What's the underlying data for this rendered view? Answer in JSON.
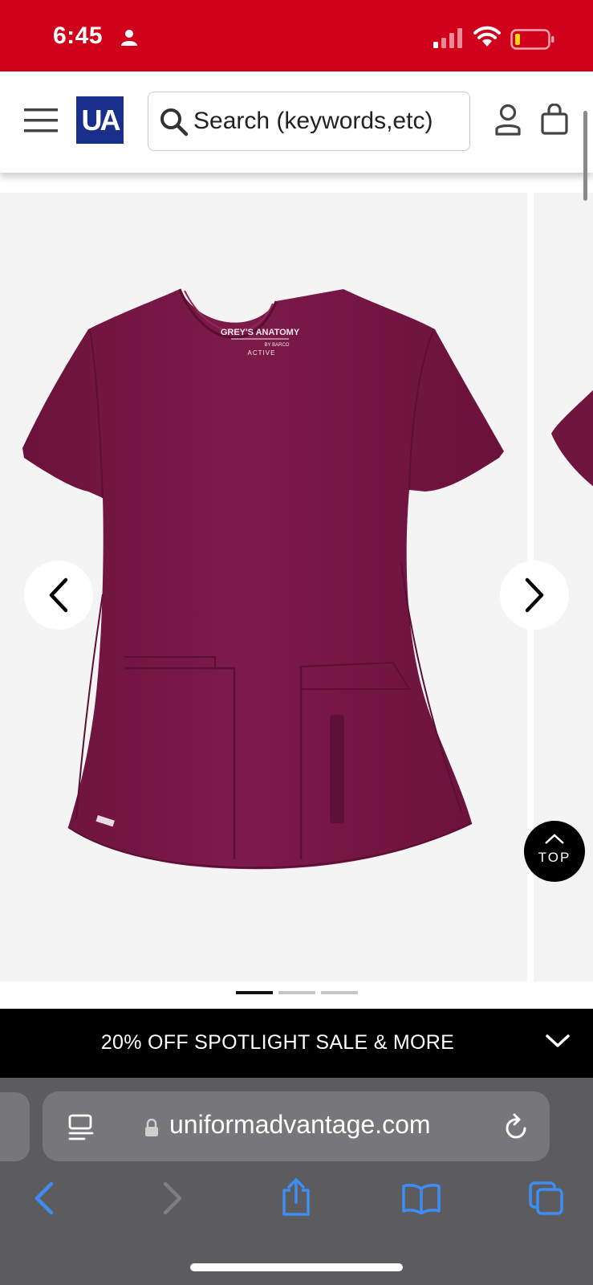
{
  "status_bar": {
    "time": "6:45",
    "background_color": "#d0021b",
    "icons": [
      "person-icon",
      "cellular-signal-icon",
      "wifi-icon",
      "battery-low-icon"
    ]
  },
  "header": {
    "menu_icon": "hamburger-menu-icon",
    "logo_text": "UA",
    "logo_color": "#1a2f8a",
    "search": {
      "placeholder": "Search (keywords,etc)",
      "value": ""
    },
    "account_icon": "account-icon",
    "bag_icon": "shopping-bag-icon"
  },
  "product": {
    "image_alt": "Wine colored scrub top",
    "garment_color": "#7a1846",
    "brand_label": "GREY'S ANATOMY",
    "brand_sublabel": "BY BARCO",
    "brand_line": "ACTIVE",
    "carousel": {
      "slide_count": 3,
      "active_slide": 1
    },
    "top_button_label": "TOP"
  },
  "promo_banner": {
    "text": "20% OFF SPOTLIGHT SALE & MORE",
    "chevron_icon": "chevron-down-icon"
  },
  "browser": {
    "url": "uniformadvantage.com",
    "toolbar": [
      "back-icon",
      "forward-icon",
      "share-icon",
      "bookmarks-icon",
      "tabs-icon"
    ]
  }
}
